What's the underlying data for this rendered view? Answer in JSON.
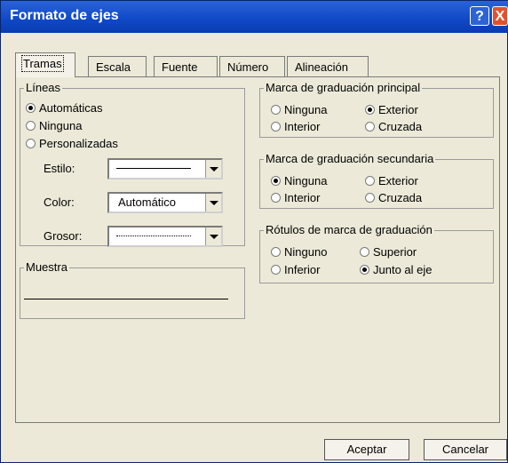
{
  "window": {
    "title": "Formato de ejes"
  },
  "titlebar": {
    "help_label": "?",
    "close_label": "X"
  },
  "tabs": [
    {
      "label": "Tramas"
    },
    {
      "label": "Escala"
    },
    {
      "label": "Fuente"
    },
    {
      "label": "Número"
    },
    {
      "label": "Alineación"
    }
  ],
  "lineas": {
    "legend": "Líneas",
    "options": [
      "Automáticas",
      "Ninguna",
      "Personalizadas"
    ],
    "selected": "Automáticas",
    "estilo_label": "Estilo:",
    "color_label": "Color:",
    "color_value": "Automático",
    "grosor_label": "Grosor:"
  },
  "muestra": {
    "legend": "Muestra"
  },
  "principal": {
    "legend": "Marca de graduación principal",
    "options": [
      "Ninguna",
      "Exterior",
      "Interior",
      "Cruzada"
    ],
    "selected": "Exterior"
  },
  "secundaria": {
    "legend": "Marca de graduación secundaria",
    "options": [
      "Ninguna",
      "Exterior",
      "Interior",
      "Cruzada"
    ],
    "selected": "Ninguna"
  },
  "rotulos": {
    "legend": "Rótulos de marca de graduación",
    "options": [
      "Ninguno",
      "Superior",
      "Inferior",
      "Junto al eje"
    ],
    "selected": "Junto al eje"
  },
  "buttons": {
    "ok": "Aceptar",
    "cancel": "Cancelar"
  }
}
